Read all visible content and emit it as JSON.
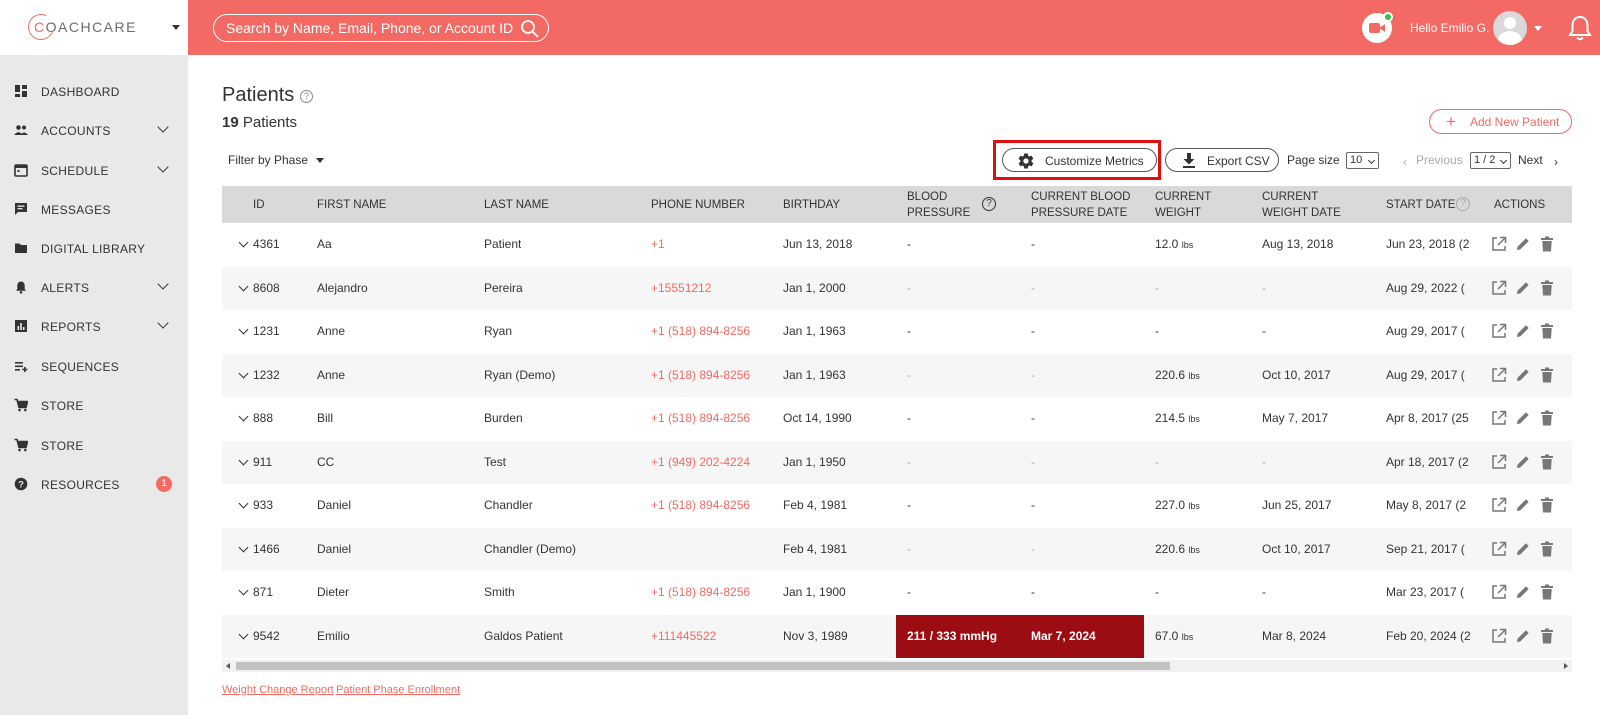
{
  "brand": {
    "logo_text_c": "C",
    "logo_text_rest": "OACHCARE",
    "accent": "#f26a63",
    "alert": "#9b0d12"
  },
  "header": {
    "search_placeholder": "Search by Name, Email, Phone, or Account ID",
    "greeting": "Hello Emilio G."
  },
  "sidebar": {
    "items": [
      {
        "label": "DASHBOARD",
        "icon": "dashboard-icon",
        "expandable": false
      },
      {
        "label": "ACCOUNTS",
        "icon": "people-icon",
        "expandable": true
      },
      {
        "label": "SCHEDULE",
        "icon": "calendar-icon",
        "expandable": true
      },
      {
        "label": "MESSAGES",
        "icon": "chat-icon",
        "expandable": false
      },
      {
        "label": "DIGITAL LIBRARY",
        "icon": "folder-icon",
        "expandable": false
      },
      {
        "label": "ALERTS",
        "icon": "bell-icon",
        "expandable": true
      },
      {
        "label": "REPORTS",
        "icon": "chart-icon",
        "expandable": true
      },
      {
        "label": "SEQUENCES",
        "icon": "sequence-icon",
        "expandable": false
      },
      {
        "label": "STORE",
        "icon": "cart-icon",
        "expandable": false
      },
      {
        "label": "STORE",
        "icon": "cart-icon",
        "expandable": false
      },
      {
        "label": "RESOURCES",
        "icon": "help-icon",
        "expandable": false,
        "badge": "1"
      }
    ]
  },
  "main": {
    "title": "Patients",
    "count_number": "19",
    "count_label": " Patients",
    "add_button": "Add New Patient",
    "filter_label": "Filter by Phase",
    "customize_button": "Customize Metrics",
    "export_button": "Export CSV",
    "page_size_label": "Page size",
    "page_size_value": "10",
    "previous_label": "Previous",
    "page_value": "1 / 2",
    "next_label": "Next",
    "footer_links": [
      "Weight Change Report",
      "Patient Phase Enrollment"
    ]
  },
  "table": {
    "headers": {
      "id": "ID",
      "first": "FIRST NAME",
      "last": "LAST NAME",
      "phone": "PHONE NUMBER",
      "birthday": "BIRTHDAY",
      "bp1": "BLOOD",
      "bp2": "PRESSURE",
      "bpd1": "CURRENT BLOOD",
      "bpd2": "PRESSURE DATE",
      "cw1": "CURRENT",
      "cw2": "WEIGHT",
      "cwd1": "CURRENT",
      "cwd2": "WEIGHT DATE",
      "start": "START DATE",
      "actions": "ACTIONS"
    },
    "weight_unit": "lbs",
    "rows": [
      {
        "id": "4361",
        "first": "Aa",
        "last": "Patient",
        "phone": "+1",
        "birthday": "Jun 13, 2018",
        "bp": "-",
        "bp_date": "-",
        "weight": "12.0",
        "weight_date": "Aug 13, 2018",
        "start": "Jun 23, 2018 (2"
      },
      {
        "id": "8608",
        "first": "Alejandro",
        "last": "Pereira",
        "phone": "+15551212",
        "birthday": "Jan 1, 2000",
        "bp": "-",
        "bp_date": "-",
        "weight": "-",
        "weight_date": "-",
        "start": "Aug 29, 2022 ("
      },
      {
        "id": "1231",
        "first": "Anne",
        "last": "Ryan",
        "phone": "+1 (518) 894-8256",
        "birthday": "Jan 1, 1963",
        "bp": "-",
        "bp_date": "-",
        "weight": "-",
        "weight_date": "-",
        "start": "Aug 29, 2017 ("
      },
      {
        "id": "1232",
        "first": "Anne",
        "last": "Ryan (Demo)",
        "phone": "+1 (518) 894-8256",
        "birthday": "Jan 1, 1963",
        "bp": "-",
        "bp_date": "-",
        "weight": "220.6",
        "weight_date": "Oct 10, 2017",
        "start": "Aug 29, 2017 ("
      },
      {
        "id": "888",
        "first": "Bill",
        "last": "Burden",
        "phone": "+1 (518) 894-8256",
        "birthday": "Oct 14, 1990",
        "bp": "-",
        "bp_date": "-",
        "weight": "214.5",
        "weight_date": "May 7, 2017",
        "start": "Apr 8, 2017 (25"
      },
      {
        "id": "911",
        "first": "CC",
        "last": "Test",
        "phone": "+1 (949) 202-4224",
        "birthday": "Jan 1, 1950",
        "bp": "-",
        "bp_date": "-",
        "weight": "-",
        "weight_date": "-",
        "start": "Apr 18, 2017 (2"
      },
      {
        "id": "933",
        "first": "Daniel",
        "last": "Chandler",
        "phone": "+1 (518) 894-8256",
        "birthday": "Feb 4, 1981",
        "bp": "-",
        "bp_date": "-",
        "weight": "227.0",
        "weight_date": "Jun 25, 2017",
        "start": "May 8, 2017 (2"
      },
      {
        "id": "1466",
        "first": "Daniel",
        "last": "Chandler (Demo)",
        "phone": "",
        "birthday": "Feb 4, 1981",
        "bp": "-",
        "bp_date": "-",
        "weight": "220.6",
        "weight_date": "Oct 10, 2017",
        "start": "Sep 21, 2017 ("
      },
      {
        "id": "871",
        "first": "Dieter",
        "last": "Smith",
        "phone": "+1 (518) 894-8256",
        "birthday": "Jan 1, 1900",
        "bp": "-",
        "bp_date": "-",
        "weight": "-",
        "weight_date": "-",
        "start": "Mar 23, 2017 ("
      },
      {
        "id": "9542",
        "first": "Emilio",
        "last": "Galdos Patient",
        "phone": "+111445522",
        "birthday": "Nov 3, 1989",
        "bp": "211 / 333 mmHg",
        "bp_date": "Mar 7, 2024",
        "weight": "67.0",
        "weight_date": "Mar 8, 2024",
        "start": "Feb 20, 2024 (2",
        "alert": true
      }
    ]
  }
}
